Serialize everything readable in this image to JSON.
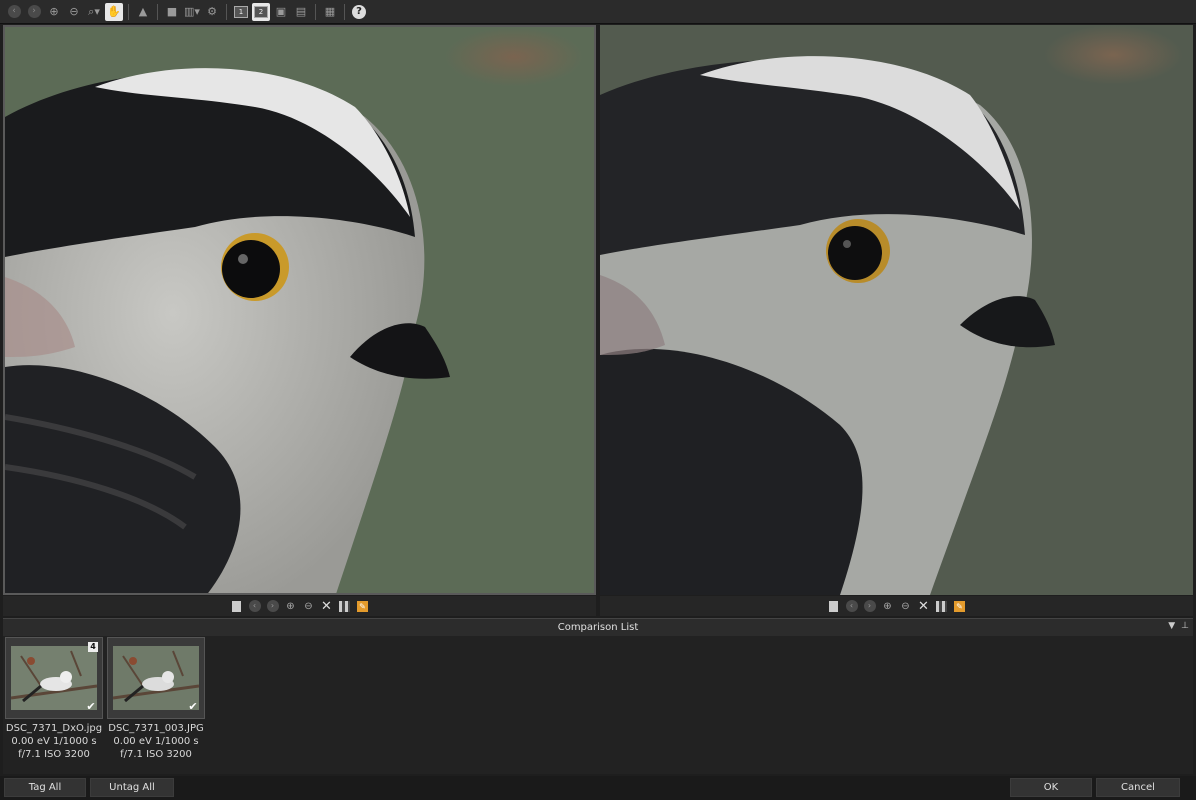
{
  "toolbar": {
    "icons": [
      "back-icon",
      "forward-icon",
      "zoom-in-icon",
      "zoom-out-icon",
      "zoom-dropdown-icon",
      "pan-hand-icon",
      "warning-icon",
      "white-square-icon",
      "histogram-icon",
      "settings-icon",
      "single-view-icon",
      "dual-view-icon",
      "compare-view-icon",
      "split-view-icon",
      "display-icon",
      "help-icon"
    ],
    "help_glyph": "?",
    "view1_label": "1",
    "view2_label": "2"
  },
  "comparison_list": {
    "title": "Comparison List",
    "items": [
      {
        "filename": "DSC_7371_DxO.jpg",
        "exposure": "0.00 eV  1/1000 s",
        "aperture_iso": "f/7.1   ISO 3200",
        "badge": "4"
      },
      {
        "filename": "DSC_7371_003.JPG",
        "exposure": "0.00 eV  1/1000 s",
        "aperture_iso": "f/7.1   ISO 3200",
        "badge": ""
      }
    ]
  },
  "footer": {
    "tag_all": "Tag All",
    "untag_all": "Untag All",
    "ok": "OK",
    "cancel": "Cancel"
  },
  "colors": {
    "accent": "#e49b2c",
    "background": "#1e1e1e"
  }
}
